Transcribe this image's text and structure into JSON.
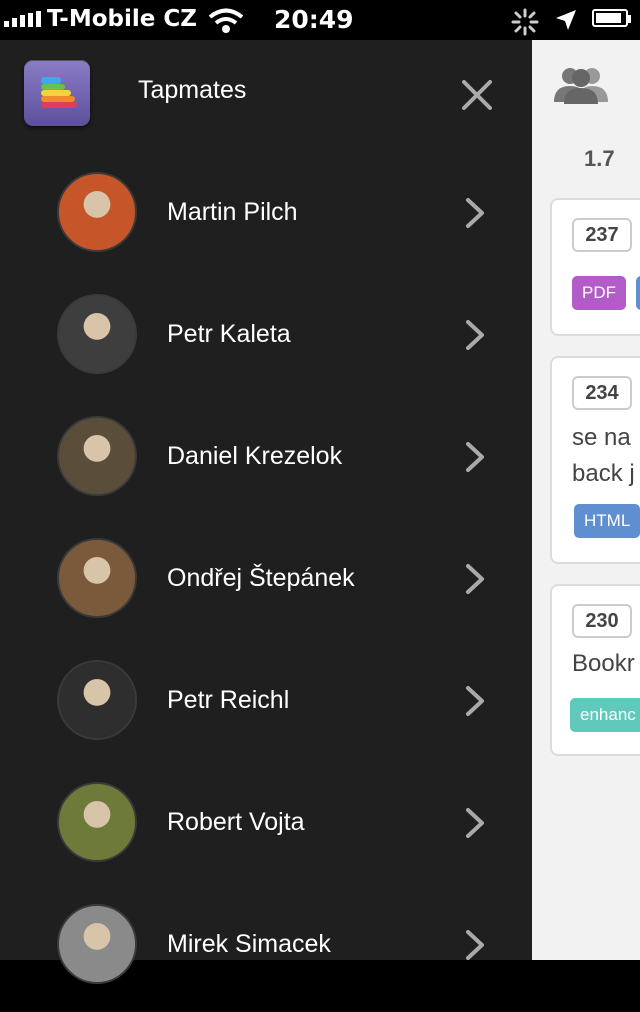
{
  "status_bar": {
    "carrier": "T-Mobile CZ",
    "time": "20:49",
    "battery_level": 0.9
  },
  "drawer": {
    "title": "Tapmates",
    "people": [
      {
        "name": "Martin Pilch",
        "avatar_color": "#c7552a"
      },
      {
        "name": "Petr Kaleta",
        "avatar_color": "#3e3e3e"
      },
      {
        "name": "Daniel Krezelok",
        "avatar_color": "#5a4e3a"
      },
      {
        "name": "Ondřej Štepánek",
        "avatar_color": "#7a5a3a"
      },
      {
        "name": "Petr Reichl",
        "avatar_color": "#2e2e2e"
      },
      {
        "name": "Robert Vojta",
        "avatar_color": "#6e7a3a"
      },
      {
        "name": "Mirek Simacek",
        "avatar_color": "#8a8a8a"
      }
    ]
  },
  "main": {
    "version": "1.7",
    "cards": [
      {
        "number": "237",
        "lines": [],
        "tags": [
          "PDF"
        ]
      },
      {
        "number": "234",
        "lines": [
          "se na",
          "back j"
        ],
        "tags": [
          "HTML"
        ]
      },
      {
        "number": "230",
        "lines": [
          "Bookr"
        ],
        "tags": [
          "enhanc"
        ]
      }
    ]
  },
  "colors": {
    "drawer_bg": "#1f1f1f",
    "main_bg": "#f2f2f2",
    "tag_pdf": "#b35cc8",
    "tag_html": "#5f8fd0",
    "tag_enhance": "#5fcabb"
  }
}
